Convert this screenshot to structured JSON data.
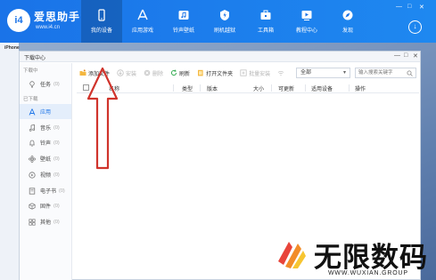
{
  "app": {
    "logo_text": "i4",
    "brand": "爱思助手",
    "url": "www.i4.cn",
    "nav": [
      {
        "label": "我的设备",
        "icon": "phone-icon"
      },
      {
        "label": "应用游戏",
        "icon": "apps-icon"
      },
      {
        "label": "铃声壁纸",
        "icon": "ringtone-icon"
      },
      {
        "label": "刷机越狱",
        "icon": "flash-icon"
      },
      {
        "label": "工具箱",
        "icon": "toolbox-icon"
      },
      {
        "label": "教程中心",
        "icon": "tutorial-icon"
      },
      {
        "label": "发现",
        "icon": "discover-icon"
      }
    ],
    "window_controls": [
      "—",
      "□",
      "✕"
    ],
    "device_label": "iPhone"
  },
  "dialog": {
    "title": "下载中心",
    "controls": [
      "—",
      "□",
      "✕"
    ],
    "groups": {
      "downloading": "下载中",
      "downloaded": "已下载"
    },
    "categories": [
      {
        "label": "任务",
        "count": "(0)",
        "icon": "task-icon",
        "active": false
      },
      {
        "label": "应用",
        "count": "",
        "icon": "app-icon",
        "active": true
      },
      {
        "label": "音乐",
        "count": "(0)",
        "icon": "music-icon",
        "active": false
      },
      {
        "label": "铃声",
        "count": "(0)",
        "icon": "bell-icon",
        "active": false
      },
      {
        "label": "壁纸",
        "count": "(0)",
        "icon": "wallpaper-icon",
        "active": false
      },
      {
        "label": "视频",
        "count": "(0)",
        "icon": "video-icon",
        "active": false
      },
      {
        "label": "电子书",
        "count": "(0)",
        "icon": "ebook-icon",
        "active": false
      },
      {
        "label": "固件",
        "count": "(0)",
        "icon": "firmware-icon",
        "active": false
      },
      {
        "label": "其他",
        "count": "(0)",
        "icon": "other-icon",
        "active": false
      }
    ],
    "toolbar": {
      "add_file": "添加文件",
      "install": "安装",
      "delete": "删除",
      "refresh": "刷新",
      "open_folder": "打开文件夹",
      "install_all": "批量安装"
    },
    "filter": {
      "selected": "全部"
    },
    "search": {
      "placeholder": "输入搜索关键字"
    },
    "columns": [
      "名称",
      "类型",
      "版本",
      "大小",
      "可更新",
      "适用设备",
      "操作"
    ]
  },
  "watermark": {
    "text": "无限数码",
    "subtext": "WWW.WUXIAN.GROUP"
  },
  "colors": {
    "accent": "#1a73e8",
    "annotation": "#d0342c"
  }
}
